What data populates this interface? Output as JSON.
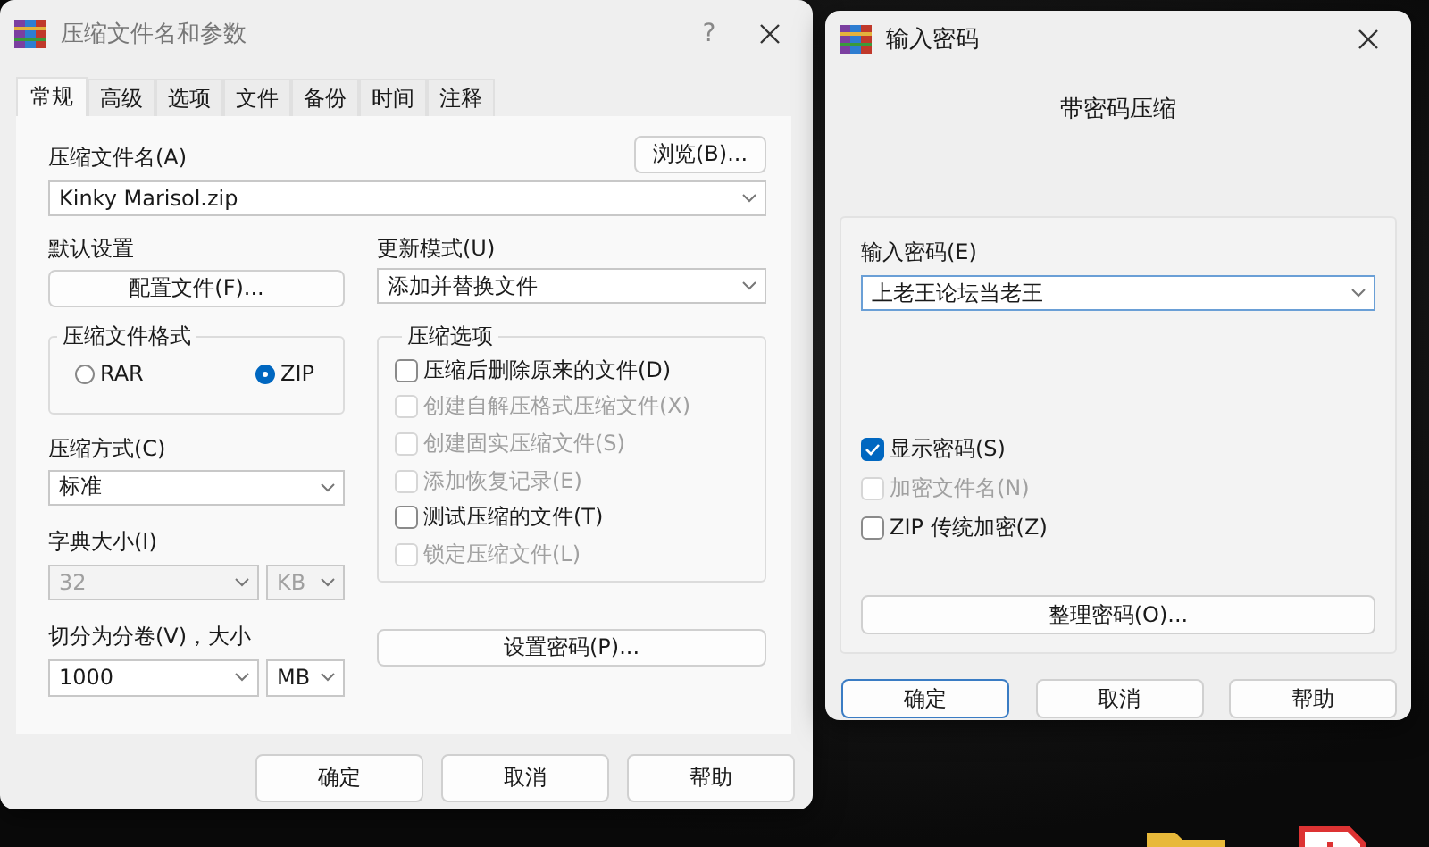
{
  "archive_dialog": {
    "title": "压缩文件名和参数",
    "help_button": "?",
    "tabs": [
      {
        "label": "常规",
        "selected": true
      },
      {
        "label": "高级",
        "selected": false
      },
      {
        "label": "选项",
        "selected": false
      },
      {
        "label": "文件",
        "selected": false
      },
      {
        "label": "备份",
        "selected": false
      },
      {
        "label": "时间",
        "selected": false
      },
      {
        "label": "注释",
        "selected": false
      }
    ],
    "archive_name": {
      "label": "压缩文件名(A)",
      "value": "Kinky Marisol.zip"
    },
    "browse_button": "浏览(B)...",
    "default_settings": {
      "label": "默认设置",
      "button": "配置文件(F)..."
    },
    "update_mode": {
      "label": "更新模式(U)",
      "value": "添加并替换文件"
    },
    "archive_format": {
      "title": "压缩文件格式",
      "options": [
        {
          "label": "RAR",
          "selected": false
        },
        {
          "label": "ZIP",
          "selected": true
        }
      ]
    },
    "compression_method": {
      "label": "压缩方式(C)",
      "value": "标准"
    },
    "dictionary_size": {
      "label": "字典大小(I)",
      "value": "32",
      "unit": "KB",
      "disabled": true
    },
    "split_volumes": {
      "label": "切分为分卷(V)，大小",
      "value": "1000",
      "unit": "MB"
    },
    "compression_options": {
      "title": "压缩选项",
      "items": [
        {
          "label": "压缩后删除原来的文件(D)",
          "checked": false,
          "disabled": false
        },
        {
          "label": "创建自解压格式压缩文件(X)",
          "checked": false,
          "disabled": true
        },
        {
          "label": "创建固实压缩文件(S)",
          "checked": false,
          "disabled": true
        },
        {
          "label": "添加恢复记录(E)",
          "checked": false,
          "disabled": true
        },
        {
          "label": "测试压缩的文件(T)",
          "checked": false,
          "disabled": false
        },
        {
          "label": "锁定压缩文件(L)",
          "checked": false,
          "disabled": true
        }
      ]
    },
    "set_password_button": "设置密码(P)...",
    "buttons": [
      {
        "label": "确定",
        "default": false
      },
      {
        "label": "取消",
        "default": false
      },
      {
        "label": "帮助",
        "default": false
      }
    ]
  },
  "password_dialog": {
    "title": "输入密码",
    "heading": "带密码压缩",
    "password": {
      "label": "输入密码(E)",
      "value": "上老王论坛当老王"
    },
    "options": [
      {
        "label": "显示密码(S)",
        "checked": true,
        "disabled": false
      },
      {
        "label": "加密文件名(N)",
        "checked": false,
        "disabled": true
      },
      {
        "label": "ZIP 传统加密(Z)",
        "checked": false,
        "disabled": false
      }
    ],
    "organize_button": "整理密码(O)...",
    "buttons": [
      {
        "label": "确定",
        "default": true
      },
      {
        "label": "取消",
        "default": false
      },
      {
        "label": "帮助",
        "default": false
      }
    ]
  }
}
